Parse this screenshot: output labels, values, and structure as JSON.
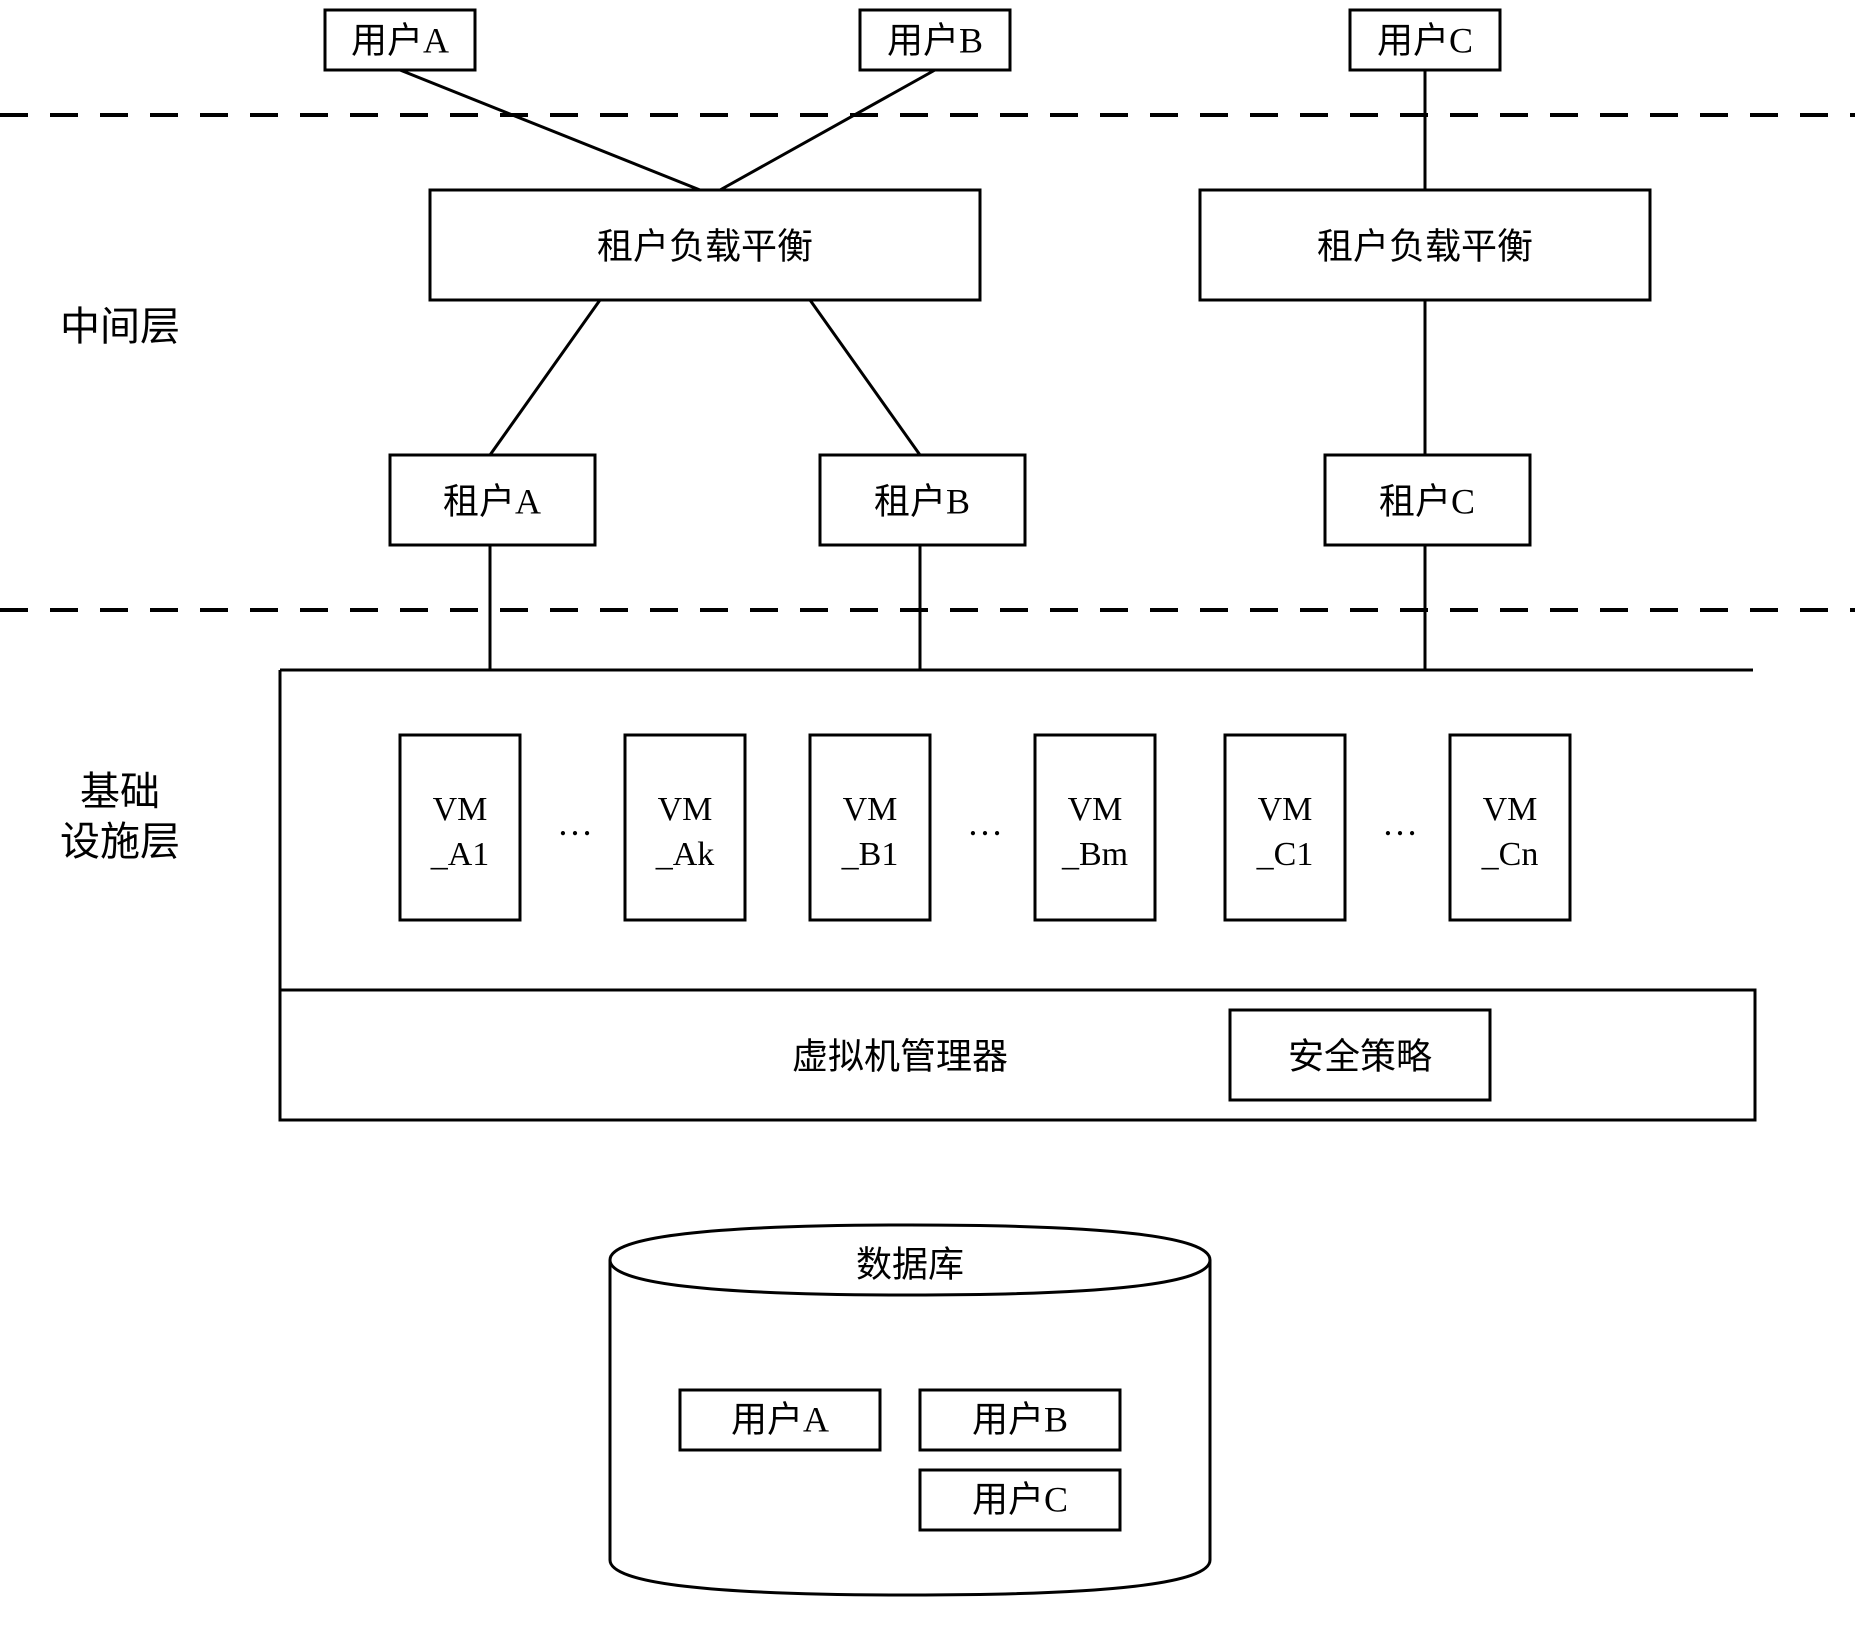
{
  "users": {
    "a": "用户A",
    "b": "用户B",
    "c": "用户C"
  },
  "layers": {
    "middle": "中间层",
    "infra1": "基础",
    "infra2": "设施层"
  },
  "lb": {
    "left": "租户负载平衡",
    "right": "租户负载平衡"
  },
  "tenants": {
    "a": "租户A",
    "b": "租户B",
    "c": "租户C"
  },
  "vms": {
    "a1_1": "VM",
    "a1_2": "_A1",
    "ak_1": "VM",
    "ak_2": "_Ak",
    "b1_1": "VM",
    "b1_2": "_B1",
    "bm_1": "VM",
    "bm_2": "_Bm",
    "c1_1": "VM",
    "c1_2": "_C1",
    "cn_1": "VM",
    "cn_2": "_Cn",
    "dots": "…"
  },
  "hypervisor": {
    "label": "虚拟机管理器",
    "policy": "安全策略"
  },
  "db": {
    "label": "数据库",
    "a": "用户A",
    "b": "用户B",
    "c": "用户C"
  }
}
